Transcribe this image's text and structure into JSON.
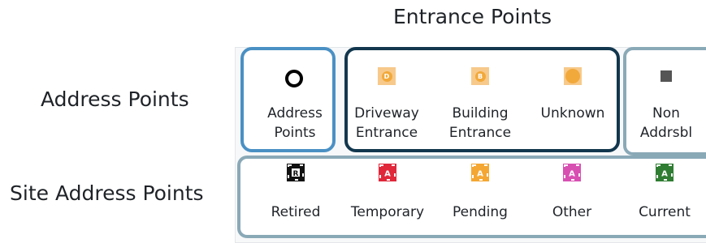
{
  "headings": {
    "entrance_points": "Entrance Points",
    "address_points": "Address Points",
    "site_address_points": "Site Address Points"
  },
  "address_group": {
    "items": [
      {
        "label": "Address\nPoints",
        "icon": "black-ring-icon"
      }
    ]
  },
  "entrance_group": {
    "items": [
      {
        "label": "Driveway\nEntrance",
        "icon": "driveway-entrance-icon",
        "glyph": "D"
      },
      {
        "label": "Building\nEntrance",
        "icon": "building-entrance-icon",
        "glyph": "B"
      },
      {
        "label": "Unknown",
        "icon": "unknown-entrance-icon",
        "glyph": ""
      }
    ]
  },
  "nonaddr_group": {
    "items": [
      {
        "label": "Non\nAddrsbl",
        "icon": "gray-square-icon"
      }
    ]
  },
  "site_group": {
    "items": [
      {
        "label": "Retired",
        "icon": "retired-site-icon",
        "glyph": "R",
        "color": "#111111"
      },
      {
        "label": "Temporary",
        "icon": "temporary-site-icon",
        "glyph": "A",
        "color": "#e0283a"
      },
      {
        "label": "Pending",
        "icon": "pending-site-icon",
        "glyph": "A",
        "color": "#f4a732"
      },
      {
        "label": "Other",
        "icon": "other-site-icon",
        "glyph": "A",
        "color": "#d84fb2"
      },
      {
        "label": "Current",
        "icon": "current-site-icon",
        "glyph": "A",
        "color": "#2f7d32"
      }
    ]
  },
  "colors": {
    "address_box": "#4a90c4",
    "entrance_box": "#12374e",
    "site_box": "#8aa9b7",
    "entrance_fill": "#f7c98a",
    "entrance_dot": "#f2a93b"
  }
}
